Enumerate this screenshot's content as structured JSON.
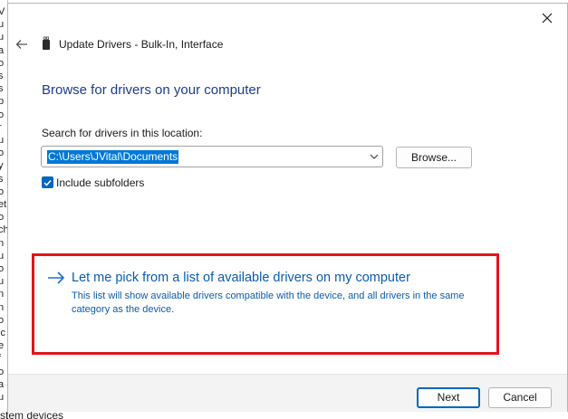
{
  "background_window": {
    "edge_chars": [
      "V",
      "u",
      "u",
      "a",
      "o",
      "s",
      "s",
      "p",
      "o",
      "r",
      "u",
      "o",
      "y",
      "s",
      "o",
      "et",
      "o",
      "ch",
      "n",
      "u",
      "o",
      "u",
      "n",
      "n",
      "o",
      "ic",
      "e",
      "f",
      "o",
      "a",
      "u"
    ],
    "bottom_text": "stem devices"
  },
  "dialog": {
    "title": "Update Drivers - Bulk-In, Interface",
    "heading": "Browse for drivers on your computer",
    "search_label": "Search for drivers in this location:",
    "path_value": "C:\\Users\\JVital\\Documents",
    "browse_label": "Browse...",
    "include_subfolders_label": "Include subfolders",
    "include_subfolders_checked": true,
    "pick_option": {
      "title": "Let me pick from a list of available drivers on my computer",
      "description": "This list will show available drivers compatible with the device, and all drivers in the same category as the device."
    },
    "buttons": {
      "next": "Next",
      "cancel": "Cancel"
    }
  },
  "icons": {
    "close": "close-icon",
    "back": "back-arrow-icon",
    "device": "usb-device-icon",
    "dropdown": "chevron-down-icon",
    "check": "checkmark-icon",
    "option_arrow": "right-arrow-icon"
  },
  "colors": {
    "accent": "#0067c0",
    "heading": "#1c3c8c",
    "link": "#0b5cad",
    "highlight_annotation": "#e0151c",
    "selection": "#0078d7",
    "footer_bg": "#f3f3f3"
  }
}
